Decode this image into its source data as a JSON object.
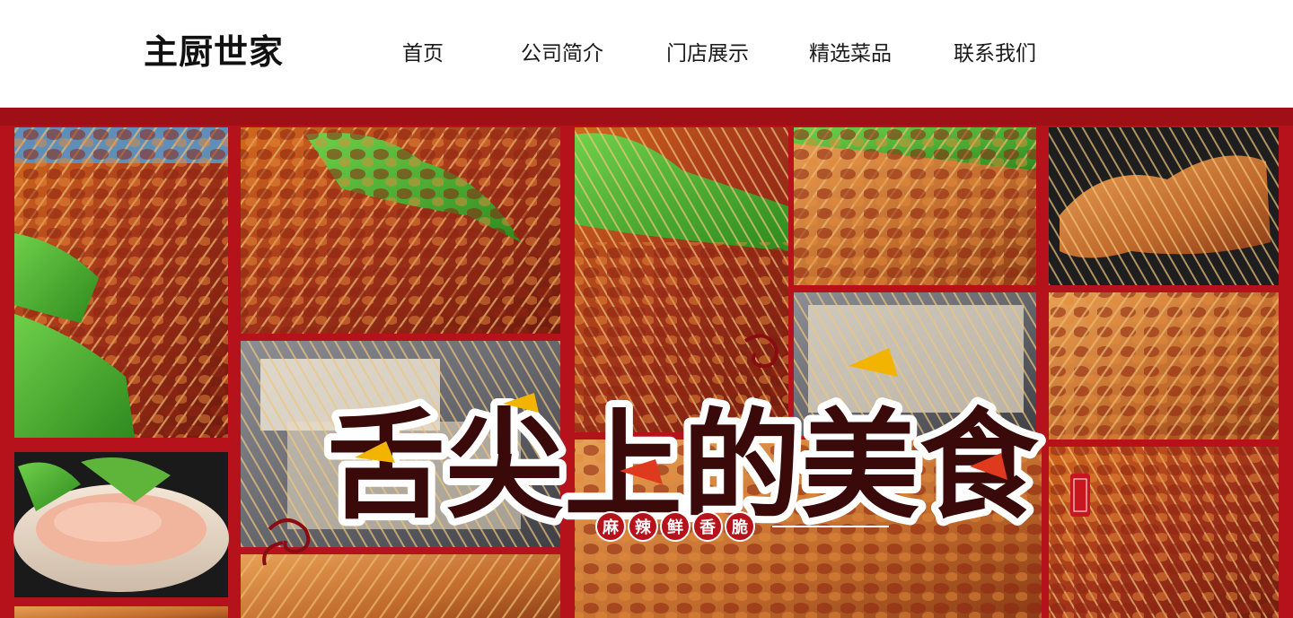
{
  "brand": {
    "logo_text": "主厨世家"
  },
  "nav": {
    "items": [
      {
        "label": "首页",
        "id": "home"
      },
      {
        "label": "公司简介",
        "id": "about"
      },
      {
        "label": "门店展示",
        "id": "stores"
      },
      {
        "label": "精选菜品",
        "id": "dishes"
      },
      {
        "label": "联系我们",
        "id": "contact"
      }
    ]
  },
  "banner": {
    "headline": "舌尖上的美食",
    "tagline": [
      "麻",
      "辣",
      "鲜",
      "香",
      "脆"
    ],
    "colors": {
      "frame_red": "#b5121b",
      "dark_red": "#7d0a10",
      "headline_dark": "#3a0a0a",
      "headline_accent": "#f2b400",
      "headline_outline": "#ffffff"
    }
  }
}
